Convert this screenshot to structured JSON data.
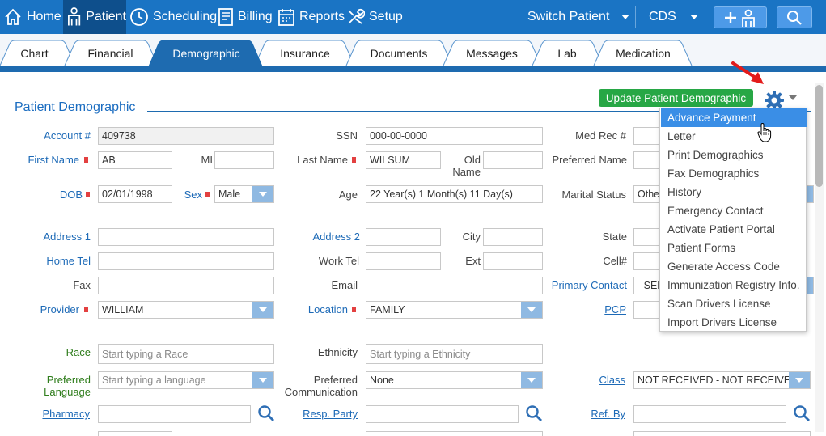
{
  "nav": {
    "home": "Home",
    "patient": "Patient",
    "scheduling": "Scheduling",
    "billing": "Billing",
    "reports": "Reports",
    "setup": "Setup",
    "switch_patient": "Switch Patient",
    "cds": "CDS"
  },
  "tabs": [
    "Chart",
    "Financial",
    "Demographic",
    "Insurance",
    "Documents",
    "Messages",
    "Lab",
    "Medication"
  ],
  "page": {
    "title": "Patient Demographic",
    "update_button": "Update Patient Demographic"
  },
  "form": {
    "account_label": "Account #",
    "account_value": "409738",
    "ssn_label": "SSN",
    "ssn_value": "000-00-0000",
    "medrec_label": "Med Rec #",
    "first_name_label": "First Name",
    "first_name_value": "AB",
    "mi_label": "MI",
    "last_name_label": "Last Name",
    "last_name_value": "WILSUM",
    "old_name_label_1": "Old",
    "old_name_label_2": "Name",
    "preferred_name_label": "Preferred Name",
    "dob_label": "DOB",
    "dob_value": "02/01/1998",
    "sex_label": "Sex",
    "sex_value": "Male",
    "age_label": "Age",
    "age_value": "22 Year(s) 1 Month(s) 11 Day(s)",
    "marital_label": "Marital Status",
    "marital_value": "Other",
    "address1_label": "Address 1",
    "address2_label": "Address 2",
    "city_label": "City",
    "state_label": "State",
    "home_tel_label": "Home Tel",
    "work_tel_label": "Work Tel",
    "ext_label": "Ext",
    "cell_label": "Cell#",
    "fax_label": "Fax",
    "email_label": "Email",
    "primary_contact_label": "Primary Contact",
    "primary_contact_value": "- SELE",
    "provider_label": "Provider",
    "provider_value": "WILLIAM",
    "location_label": "Location",
    "location_value": "FAMILY",
    "pcp_label": "PCP",
    "race_label": "Race",
    "race_placeholder": "Start typing a Race",
    "ethnicity_label": "Ethnicity",
    "ethnicity_placeholder": "Start typing a Ethnicity",
    "pref_lang_label_1": "Preferred",
    "pref_lang_label_2": "Language",
    "pref_lang_placeholder": "Start typing a language",
    "pref_comm_label_1": "Preferred",
    "pref_comm_label_2": "Communication",
    "pref_comm_value": "None",
    "class_label": "Class",
    "class_value": "NOT RECEIVED - NOT RECEIVED",
    "pharmacy_label": "Pharmacy",
    "resp_party_label": "Resp. Party",
    "ref_by_label": "Ref. By"
  },
  "menu": {
    "items": [
      "Advance Payment",
      "Letter",
      "Print Demographics",
      "Fax Demographics",
      "History",
      "Emergency Contact",
      "Activate Patient Portal",
      "Patient Forms",
      "Generate Access Code",
      "Immunization Registry Info.",
      "Scan Drivers License",
      "Import Drivers License"
    ],
    "highlighted_index": 0
  },
  "colors": {
    "topbar": "#1a74c4",
    "active_tab": "#1e6bb0",
    "update_button": "#27a745",
    "required_marker": "#e34040",
    "menu_highlight": "#3a8ee6"
  }
}
